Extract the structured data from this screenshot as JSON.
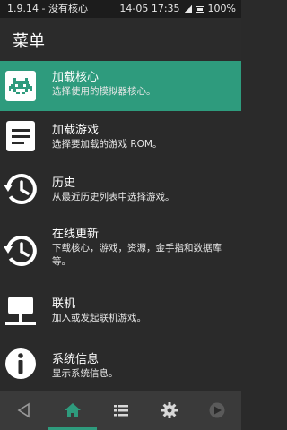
{
  "status_bar": {
    "left_text": "1.9.14 - 没有核心",
    "time_text": "14-05 17:35",
    "battery_text": "100%"
  },
  "header": {
    "title": "菜单"
  },
  "menu": [
    {
      "title": "加载核心",
      "subtitle": "选择使用的模拟器核心。",
      "icon": "invader-icon",
      "active": true
    },
    {
      "title": "加载游戏",
      "subtitle": "选择要加载的游戏 ROM。",
      "icon": "document-icon",
      "active": false
    },
    {
      "title": "历史",
      "subtitle": "从最近历史列表中选择游戏。",
      "icon": "history-icon",
      "active": false
    },
    {
      "title": "在线更新",
      "subtitle": "下载核心，游戏，资源，金手指和数据库等。",
      "icon": "online-update-icon",
      "active": false
    },
    {
      "title": "联机",
      "subtitle": "加入或发起联机游戏。",
      "icon": "netplay-icon",
      "active": false
    },
    {
      "title": "系统信息",
      "subtitle": "显示系统信息。",
      "icon": "info-icon",
      "active": false
    }
  ],
  "bottom_nav": [
    {
      "name": "back-icon",
      "active": false
    },
    {
      "name": "home-icon",
      "active": true
    },
    {
      "name": "list-icon",
      "active": false
    },
    {
      "name": "settings-icon",
      "active": false
    },
    {
      "name": "play-icon",
      "active": false
    }
  ],
  "colors": {
    "accent": "#2e9b7d",
    "background": "#2a2a2a",
    "bottom_nav": "#3a3a3a"
  }
}
